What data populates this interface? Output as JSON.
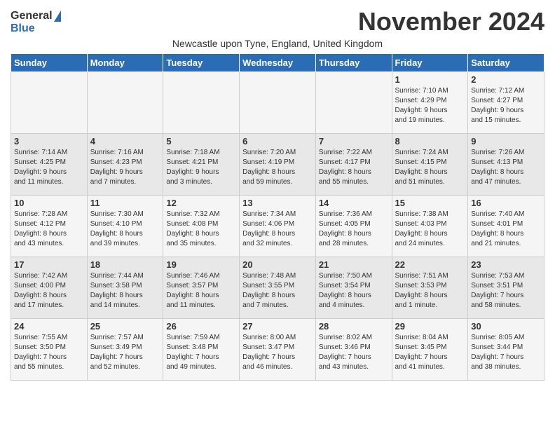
{
  "logo": {
    "general": "General",
    "blue": "Blue"
  },
  "title": "November 2024",
  "subtitle": "Newcastle upon Tyne, England, United Kingdom",
  "weekdays": [
    "Sunday",
    "Monday",
    "Tuesday",
    "Wednesday",
    "Thursday",
    "Friday",
    "Saturday"
  ],
  "weeks": [
    [
      {
        "day": "",
        "info": ""
      },
      {
        "day": "",
        "info": ""
      },
      {
        "day": "",
        "info": ""
      },
      {
        "day": "",
        "info": ""
      },
      {
        "day": "",
        "info": ""
      },
      {
        "day": "1",
        "info": "Sunrise: 7:10 AM\nSunset: 4:29 PM\nDaylight: 9 hours\nand 19 minutes."
      },
      {
        "day": "2",
        "info": "Sunrise: 7:12 AM\nSunset: 4:27 PM\nDaylight: 9 hours\nand 15 minutes."
      }
    ],
    [
      {
        "day": "3",
        "info": "Sunrise: 7:14 AM\nSunset: 4:25 PM\nDaylight: 9 hours\nand 11 minutes."
      },
      {
        "day": "4",
        "info": "Sunrise: 7:16 AM\nSunset: 4:23 PM\nDaylight: 9 hours\nand 7 minutes."
      },
      {
        "day": "5",
        "info": "Sunrise: 7:18 AM\nSunset: 4:21 PM\nDaylight: 9 hours\nand 3 minutes."
      },
      {
        "day": "6",
        "info": "Sunrise: 7:20 AM\nSunset: 4:19 PM\nDaylight: 8 hours\nand 59 minutes."
      },
      {
        "day": "7",
        "info": "Sunrise: 7:22 AM\nSunset: 4:17 PM\nDaylight: 8 hours\nand 55 minutes."
      },
      {
        "day": "8",
        "info": "Sunrise: 7:24 AM\nSunset: 4:15 PM\nDaylight: 8 hours\nand 51 minutes."
      },
      {
        "day": "9",
        "info": "Sunrise: 7:26 AM\nSunset: 4:13 PM\nDaylight: 8 hours\nand 47 minutes."
      }
    ],
    [
      {
        "day": "10",
        "info": "Sunrise: 7:28 AM\nSunset: 4:12 PM\nDaylight: 8 hours\nand 43 minutes."
      },
      {
        "day": "11",
        "info": "Sunrise: 7:30 AM\nSunset: 4:10 PM\nDaylight: 8 hours\nand 39 minutes."
      },
      {
        "day": "12",
        "info": "Sunrise: 7:32 AM\nSunset: 4:08 PM\nDaylight: 8 hours\nand 35 minutes."
      },
      {
        "day": "13",
        "info": "Sunrise: 7:34 AM\nSunset: 4:06 PM\nDaylight: 8 hours\nand 32 minutes."
      },
      {
        "day": "14",
        "info": "Sunrise: 7:36 AM\nSunset: 4:05 PM\nDaylight: 8 hours\nand 28 minutes."
      },
      {
        "day": "15",
        "info": "Sunrise: 7:38 AM\nSunset: 4:03 PM\nDaylight: 8 hours\nand 24 minutes."
      },
      {
        "day": "16",
        "info": "Sunrise: 7:40 AM\nSunset: 4:01 PM\nDaylight: 8 hours\nand 21 minutes."
      }
    ],
    [
      {
        "day": "17",
        "info": "Sunrise: 7:42 AM\nSunset: 4:00 PM\nDaylight: 8 hours\nand 17 minutes."
      },
      {
        "day": "18",
        "info": "Sunrise: 7:44 AM\nSunset: 3:58 PM\nDaylight: 8 hours\nand 14 minutes."
      },
      {
        "day": "19",
        "info": "Sunrise: 7:46 AM\nSunset: 3:57 PM\nDaylight: 8 hours\nand 11 minutes."
      },
      {
        "day": "20",
        "info": "Sunrise: 7:48 AM\nSunset: 3:55 PM\nDaylight: 8 hours\nand 7 minutes."
      },
      {
        "day": "21",
        "info": "Sunrise: 7:50 AM\nSunset: 3:54 PM\nDaylight: 8 hours\nand 4 minutes."
      },
      {
        "day": "22",
        "info": "Sunrise: 7:51 AM\nSunset: 3:53 PM\nDaylight: 8 hours\nand 1 minute."
      },
      {
        "day": "23",
        "info": "Sunrise: 7:53 AM\nSunset: 3:51 PM\nDaylight: 7 hours\nand 58 minutes."
      }
    ],
    [
      {
        "day": "24",
        "info": "Sunrise: 7:55 AM\nSunset: 3:50 PM\nDaylight: 7 hours\nand 55 minutes."
      },
      {
        "day": "25",
        "info": "Sunrise: 7:57 AM\nSunset: 3:49 PM\nDaylight: 7 hours\nand 52 minutes."
      },
      {
        "day": "26",
        "info": "Sunrise: 7:59 AM\nSunset: 3:48 PM\nDaylight: 7 hours\nand 49 minutes."
      },
      {
        "day": "27",
        "info": "Sunrise: 8:00 AM\nSunset: 3:47 PM\nDaylight: 7 hours\nand 46 minutes."
      },
      {
        "day": "28",
        "info": "Sunrise: 8:02 AM\nSunset: 3:46 PM\nDaylight: 7 hours\nand 43 minutes."
      },
      {
        "day": "29",
        "info": "Sunrise: 8:04 AM\nSunset: 3:45 PM\nDaylight: 7 hours\nand 41 minutes."
      },
      {
        "day": "30",
        "info": "Sunrise: 8:05 AM\nSunset: 3:44 PM\nDaylight: 7 hours\nand 38 minutes."
      }
    ]
  ]
}
